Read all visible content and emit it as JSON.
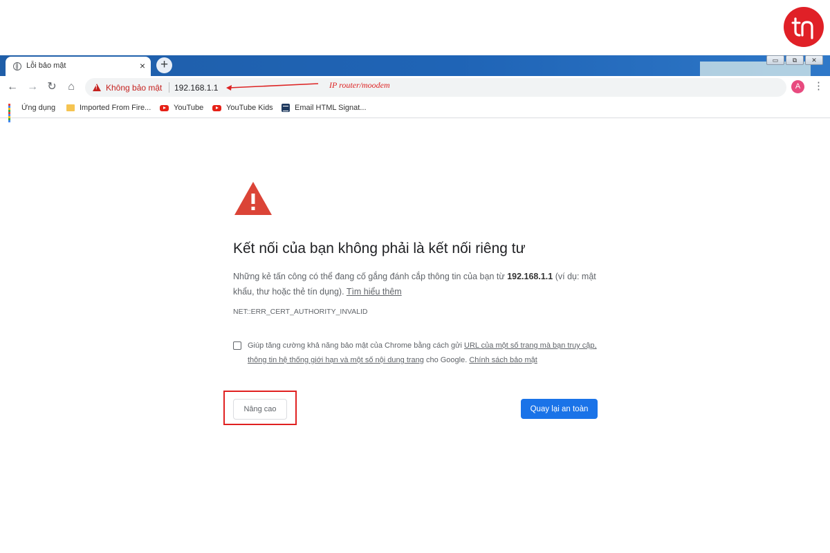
{
  "brand": {
    "logo_color": "#e02027"
  },
  "browser": {
    "tab": {
      "title": "Lỗi bảo mật",
      "close": "×"
    },
    "new_tab": "+",
    "window_buttons": [
      "▭",
      "⧉",
      "✕"
    ],
    "toolbar": {
      "back": "←",
      "forward": "→",
      "reload": "↻",
      "home": "⌂",
      "security_label": "Không bảo mật",
      "url": "192.168.1.1",
      "annotation": "IP router/moodem",
      "star": "☆",
      "avatar_initial": "A",
      "menu": "⋮"
    },
    "bookmarks": [
      {
        "label": "Ứng dụng",
        "icon": "apps-grid-icon"
      },
      {
        "label": "Imported From Fire...",
        "icon": "folder-icon"
      },
      {
        "label": "YouTube",
        "icon": "youtube-icon"
      },
      {
        "label": "YouTube Kids",
        "icon": "youtube-icon"
      },
      {
        "label": "Email HTML Signat...",
        "icon": "document-icon"
      }
    ]
  },
  "interstitial": {
    "heading": "Kết nối của bạn không phải là kết nối riêng tư",
    "desc_before": "Những kẻ tấn công có thể đang cố gắng đánh cắp thông tin của bạn từ ",
    "desc_host": "192.168.1.1",
    "desc_after": " (ví dụ: mật khẩu, thư hoặc thẻ tín dụng). ",
    "learn_more": "Tìm hiểu thêm",
    "error_code": "NET::ERR_CERT_AUTHORITY_INVALID",
    "optin_before": "Giúp tăng cường khả năng bảo mật của Chrome bằng cách gửi ",
    "optin_link": "URL của một số trang mà bạn truy cập, thông tin hệ thống giới hạn và một số nội dung trang",
    "optin_mid": " cho Google. ",
    "privacy_link": "Chính sách bảo mật",
    "advanced_button": "Nâng cao",
    "back_button": "Quay lại an toàn",
    "warning_color": "#db4437",
    "primary_color": "#1a73e8"
  }
}
